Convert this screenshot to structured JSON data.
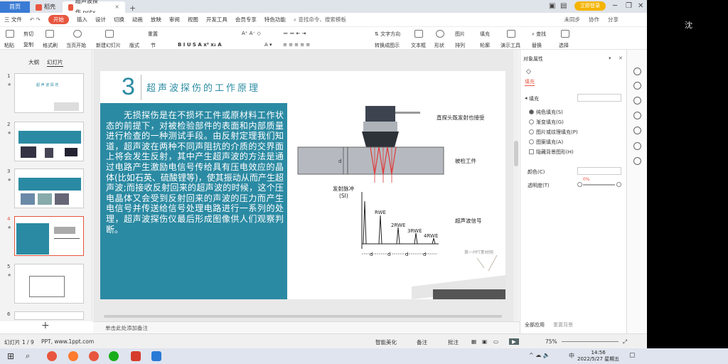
{
  "titlebar": {
    "home_tab": "首页",
    "docer_tab": "稻壳",
    "file_tab": "超声波探伤.pptx",
    "login": "立即登录"
  },
  "menu": {
    "file": "三 文件",
    "items": [
      "开始",
      "插入",
      "设计",
      "切换",
      "动画",
      "放映",
      "审阅",
      "视图",
      "开发工具",
      "会员专享",
      "特色功能"
    ],
    "search": "查找命令、搜索模板",
    "right_items": [
      "未同步",
      "协作",
      "分享"
    ]
  },
  "ribbon": {
    "paste": "粘贴",
    "cut": "剪切",
    "copy": "复制",
    "format_painter": "格式刷",
    "from_start": "当页开始",
    "new_slide": "新建幻灯片",
    "layout": "版式",
    "section": "节",
    "reset": "重置",
    "text_box": "文本框",
    "shape": "形状",
    "arrange": "排列",
    "outline": "轮廓",
    "picture": "图片",
    "fill": "填充",
    "find": "查找",
    "replace": "替换",
    "select": "选择",
    "show_slideshow": "演示工具",
    "textbox_label": "文本框",
    "convert_smartart": "转换成图示",
    "font_default": "",
    "size_default": "0"
  },
  "sidebar": {
    "tab_outline": "大纲",
    "tab_slides": "幻灯片",
    "slides": [
      {
        "num": "1",
        "star": "★",
        "title": "超 声 波 探 伤"
      },
      {
        "num": "2",
        "star": "★",
        "title": ""
      },
      {
        "num": "3",
        "star": "★",
        "title": ""
      },
      {
        "num": "4",
        "star": "★",
        "title": ""
      },
      {
        "num": "5",
        "star": "★",
        "title": ""
      },
      {
        "num": "6",
        "star": "",
        "title": ""
      }
    ]
  },
  "slide": {
    "number": "3",
    "title": "超声波探伤的工作原理",
    "body": "　　无损探伤是在不损坏工件或原材料工作状态的前提下，对被检验部件的表面和内部质量进行检查的一种测试手段。由反射定理我们知道，超声波在两种不同声阻抗的介质的交界面上将会发生反射，其中产生超声波的方法是通过电路产生激励电信号传给具有压电效应的晶体(比如石英、硫酸锂等)，使其振动从而产生超声波;而接收反射回来的超声波的时候，这个压电晶体又会受到反射回来的声波的压力而产生电信号并传送给信号处理电路进行一系列的处理，超声波探伤仪最后形成图像供人们观察判断。",
    "diagram": {
      "probe_label": "直探头既发射也接受",
      "workpiece_label": "被检工件",
      "signal_label": "超声波信号",
      "emit_label": "发射脉冲",
      "emit_sub": "(SI)",
      "d_label": "d",
      "echoes": [
        "RWE",
        "2RWE",
        "3RWE",
        "4RWE"
      ],
      "spacing_labels": [
        "d",
        "d",
        "d",
        "d"
      ],
      "watermark": "第一PPT素材网"
    }
  },
  "notes": {
    "placeholder": "单击此处添加备注"
  },
  "properties": {
    "header": "对象属性",
    "tab_fill": "填充",
    "section_fill": "填充",
    "options": [
      "纯色填充(S)",
      "渐变填充(G)",
      "图片或纹理填充(P)",
      "图案填充(A)",
      "隐藏背景图形(H)"
    ],
    "color_label": "颜色(C)",
    "transparency_label": "透明度(T)",
    "transparency_value": "0%",
    "apply_all": "全部应用",
    "reset_bg": "重置背景"
  },
  "status": {
    "slide_counter": "幻灯片 1 / 9",
    "theme": "PPT, www.1ppt.com",
    "beautify": "智能美化",
    "notes": "备注",
    "comments": "批注",
    "zoom": "75%"
  },
  "taskbar": {
    "time": "14:56",
    "date": "2022/5/27 星期五",
    "ime": "中"
  },
  "outside": {
    "right_char": "沈"
  }
}
